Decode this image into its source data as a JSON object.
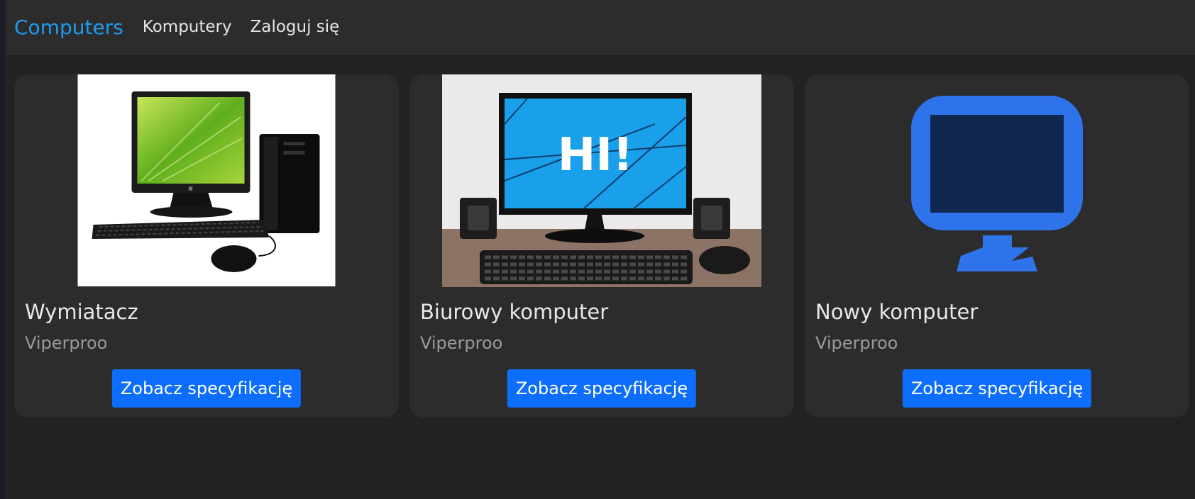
{
  "navbar": {
    "brand": "Computers",
    "links": [
      "Komputery",
      "Zaloguj się"
    ]
  },
  "cards": [
    {
      "title": "Wymiatacz",
      "author": "Viperproo",
      "button_label": "Zobacz specyfikację"
    },
    {
      "title": "Biurowy komputer",
      "author": "Viperproo",
      "button_label": "Zobacz specyfikację",
      "screen_text": "HI!"
    },
    {
      "title": "Nowy komputer",
      "author": "Viperproo",
      "button_label": "Zobacz specyfikację"
    }
  ],
  "colors": {
    "page_bg": "#222222",
    "navbar_bg": "#2c2c2c",
    "card_bg": "#2c2c2c",
    "brand": "#1e9bf0",
    "button": "#0d6efd",
    "placeholder_icon": "#2f73ea",
    "placeholder_screen": "#102850"
  }
}
